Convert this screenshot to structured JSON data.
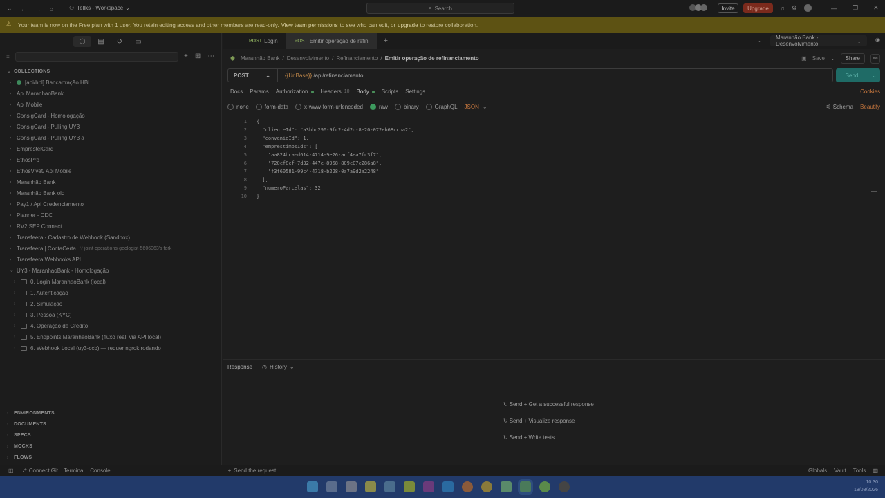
{
  "titlebar": {
    "workspace": "Tellks - Workspace",
    "search_placeholder": "Search",
    "invite": "Invite",
    "upgrade": "Upgrade"
  },
  "banner": {
    "text_before": "Your team is now on the Free plan with 1 user. You retain editing access and other members are read-only.",
    "link1": "View team permissions",
    "text_middle": "to see who can edit, or",
    "link2": "upgrade",
    "text_after": "to restore collaboration."
  },
  "sidebar": {
    "collections_label": "COLLECTIONS",
    "collections": [
      {
        "label": "[api/hbl] Bancartração HBI",
        "dot": true
      },
      {
        "label": "Api MaranhaoBank"
      },
      {
        "label": "Api Mobile"
      },
      {
        "label": "ConsigCard - Homologação"
      },
      {
        "label": "ConsigCard - Pulling UY3"
      },
      {
        "label": "ConsigCard - Pulling UY3 a"
      },
      {
        "label": "EmprestelCard"
      },
      {
        "label": "EthosPro"
      },
      {
        "label": "EthosVivet/ Api Mobile"
      },
      {
        "label": "Maranhão Bank"
      },
      {
        "label": "Maranhão Bank old"
      },
      {
        "label": "Pay1 / Api Credenciamento"
      },
      {
        "label": "Planner - CDC"
      },
      {
        "label": "RV2 SEP Connect"
      },
      {
        "label": "Transfeera - Cadastro de Webhook (Sandbox)"
      },
      {
        "label": "Transfeera | ContaCerta",
        "fork": "joint-operations-geologist-5606063's fork"
      },
      {
        "label": "Transfeera Webhooks API"
      },
      {
        "label": "UY3 - MaranhaoBank - Homologação",
        "expanded": true
      }
    ],
    "folders": [
      "0. Login MaranhaoBank (local)",
      "1. Autenticação",
      "2. Simulação",
      "3. Pessoa (KYC)",
      "4. Operação de Crédito",
      "5. Endpoints MaranhaoBank (fluxo real, via API local)",
      "6. Webhook Local (uy3-ccb) — requer ngrok rodando"
    ],
    "sections": [
      "ENVIRONMENTS",
      "DOCUMENTS",
      "SPECS",
      "MOCKS",
      "FLOWS"
    ]
  },
  "tabs": [
    {
      "method": "POST",
      "label": "Login"
    },
    {
      "method": "POST",
      "label": "Emitir operação de refin",
      "active": true
    }
  ],
  "environment": "Maranhão Bank - Desenvolvimento",
  "breadcrumb": {
    "items": [
      "Maranhão Bank",
      "Desenvolvimento",
      "Refinanciamento"
    ],
    "current": "Emitir operação de refinanciamento",
    "save": "Save",
    "share": "Share"
  },
  "request": {
    "method": "POST",
    "url_var": "{{UriBase}}",
    "url_path": " /api/refinanciamento",
    "send": "Send"
  },
  "subtabs": {
    "docs": "Docs",
    "params": "Params",
    "authorization": "Authorization",
    "headers": "Headers",
    "headers_count": "10",
    "body": "Body",
    "scripts": "Scripts",
    "settings": "Settings",
    "cookies": "Cookies"
  },
  "body_options": {
    "none": "none",
    "form_data": "form-data",
    "urlencoded": "x-www-form-urlencoded",
    "raw": "raw",
    "binary": "binary",
    "graphql": "GraphQL",
    "format": "JSON",
    "schema": "Schema",
    "beautify": "Beautify"
  },
  "code_lines": [
    "{",
    "  \"clienteId\": \"a3bbd296-9fc2-4d2d-8e20-072eb68ccba2\",",
    "  \"convenioId\": 1,",
    "  \"emprestimosIds\": [",
    "    \"aa824bca-d614-4714-9e26-acf4ea7fc3f7\",",
    "    \"720cf8cf-7d32-447e-8958-809c07c286a8\",",
    "    \"f3f60581-99c4-4718-b228-0a7a9d2a2248\"",
    "  ],",
    "  \"numeroParcelas\": 32",
    "}"
  ],
  "response": {
    "label": "Response",
    "history": "History",
    "hints": [
      "Send + Get a successful response",
      "Send + Visualize response",
      "Send + Write tests"
    ]
  },
  "footer": {
    "connect_git": "Connect Git",
    "terminal": "Terminal",
    "console": "Console",
    "send_request": "Send the request",
    "globals": "Globals",
    "vault": "Vault",
    "tools": "Tools"
  },
  "taskbar": {
    "time": "10:30",
    "date": "18/08/2026"
  },
  "colors": {
    "banner_bg": "#5d5213",
    "upgrade_bg": "#7b2a1c",
    "send_bg": "#1f6b66",
    "taskbar_bg": "#223a6a",
    "accent_orange": "#c9783e"
  }
}
